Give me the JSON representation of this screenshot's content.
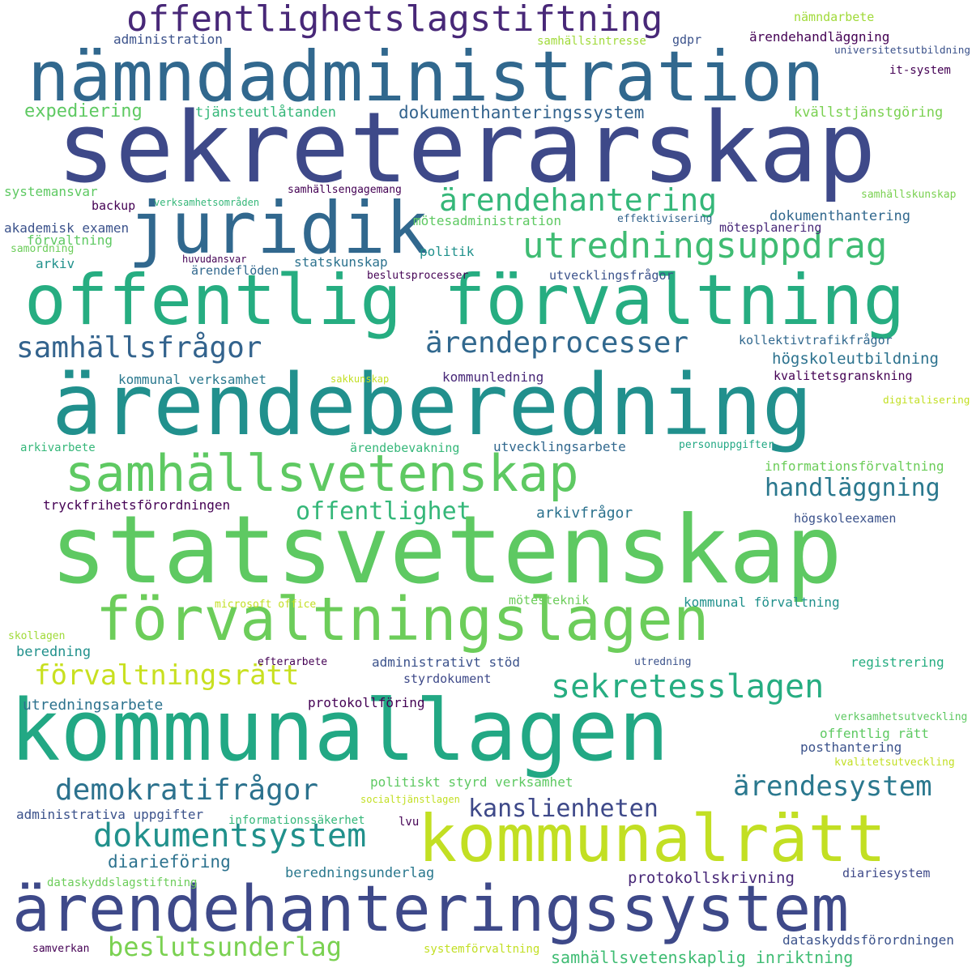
{
  "palette": {
    "background": "#ffffff",
    "dark_purple": "#440154",
    "indigo": "#3b4f8a",
    "blue": "#2f6b8e",
    "teal": "#21918c",
    "green_teal": "#28ae80",
    "green": "#5ec962",
    "light_green": "#9bd93c",
    "yellow_green": "#c2df23"
  },
  "words": [
    {
      "text": "offentlighetslagstiftning",
      "size": 44,
      "color": "#482878"
    },
    {
      "text": "nämndadministration",
      "size": 86,
      "color": "#31688e"
    },
    {
      "text": "sekreterarskap",
      "size": 120,
      "color": "#3e4989"
    },
    {
      "text": "juridik",
      "size": 88,
      "color": "#31688e"
    },
    {
      "text": "ärendehantering",
      "size": 38,
      "color": "#35b779"
    },
    {
      "text": "utredningsuppdrag",
      "size": 44,
      "color": "#3fbc73"
    },
    {
      "text": "offentlig förvaltning",
      "size": 86,
      "color": "#26ad81"
    },
    {
      "text": "samhällsfrågor",
      "size": 36,
      "color": "#33638d"
    },
    {
      "text": "ärendeprocesser",
      "size": 36,
      "color": "#31688e"
    },
    {
      "text": "ärendeberedning",
      "size": 104,
      "color": "#21908d"
    },
    {
      "text": "samhällsvetenskap",
      "size": 62,
      "color": "#5ec962"
    },
    {
      "text": "handläggning",
      "size": 30,
      "color": "#2a788e"
    },
    {
      "text": "offentlighet",
      "size": 30,
      "color": "#35b779"
    },
    {
      "text": "statsvetenskap",
      "size": 116,
      "color": "#5ec962"
    },
    {
      "text": "förvaltningslagen",
      "size": 74,
      "color": "#6ccd5a"
    },
    {
      "text": "förvaltningsrätt",
      "size": 34,
      "color": "#c8e020"
    },
    {
      "text": "sekretesslagen",
      "size": 40,
      "color": "#26ad81"
    },
    {
      "text": "kommunallagen",
      "size": 104,
      "color": "#22a884"
    },
    {
      "text": "demokratifrågor",
      "size": 36,
      "color": "#2c728e"
    },
    {
      "text": "ärendesystem",
      "size": 34,
      "color": "#2a788e"
    },
    {
      "text": "kanslienheten",
      "size": 30,
      "color": "#3e4989"
    },
    {
      "text": "dokumentsystem",
      "size": 40,
      "color": "#21918c"
    },
    {
      "text": "kommunalrätt",
      "size": 80,
      "color": "#c2df23"
    },
    {
      "text": "ärendehanteringssystem",
      "size": 78,
      "color": "#3e4989"
    },
    {
      "text": "beslutsunderlag",
      "size": 32,
      "color": "#7ad151"
    },
    {
      "text": "samhällsvetenskaplig inriktning",
      "size": 20,
      "color": "#3fbc73"
    },
    {
      "text": "administration",
      "size": 16,
      "color": "#3b528b"
    },
    {
      "text": "samhällsintresse",
      "size": 14,
      "color": "#a0da39"
    },
    {
      "text": "gdpr",
      "size": 15,
      "color": "#3b528b"
    },
    {
      "text": "nämndarbete",
      "size": 15,
      "color": "#a0da39"
    },
    {
      "text": "ärendehandläggning",
      "size": 16,
      "color": "#440154"
    },
    {
      "text": "universitetsutbildning",
      "size": 13,
      "color": "#3b528b"
    },
    {
      "text": "it-system",
      "size": 14,
      "color": "#440154"
    },
    {
      "text": "expediering",
      "size": 22,
      "color": "#5ec962"
    },
    {
      "text": "tjänsteutlåtanden",
      "size": 17,
      "color": "#35b779"
    },
    {
      "text": "dokumenthanteringssystem",
      "size": 21,
      "color": "#33638d"
    },
    {
      "text": "kvällstjänstgöring",
      "size": 17,
      "color": "#7ad151"
    },
    {
      "text": "systemansvar",
      "size": 16,
      "color": "#5ec962"
    },
    {
      "text": "samhällsengagemang",
      "size": 13,
      "color": "#440154"
    },
    {
      "text": "samhällskunskap",
      "size": 13,
      "color": "#7ad151"
    },
    {
      "text": "backup",
      "size": 15,
      "color": "#440154"
    },
    {
      "text": "verksamhetsområden",
      "size": 12,
      "color": "#35b779"
    },
    {
      "text": "mötesadministration",
      "size": 16,
      "color": "#5ec962"
    },
    {
      "text": "effektivisering",
      "size": 13,
      "color": "#33638d"
    },
    {
      "text": "dokumenthantering",
      "size": 17,
      "color": "#31688e"
    },
    {
      "text": "mötesplanering",
      "size": 15,
      "color": "#482878"
    },
    {
      "text": "akademisk examen",
      "size": 16,
      "color": "#3b528b"
    },
    {
      "text": "förvaltning",
      "size": 16,
      "color": "#5ec962"
    },
    {
      "text": "samordning",
      "size": 13,
      "color": "#6ccd5a"
    },
    {
      "text": "politik",
      "size": 16,
      "color": "#21918c"
    },
    {
      "text": "arkiv",
      "size": 16,
      "color": "#21918c"
    },
    {
      "text": "huvudansvar",
      "size": 12,
      "color": "#440154"
    },
    {
      "text": "statskunskap",
      "size": 16,
      "color": "#2c728e"
    },
    {
      "text": "ärendeflöden",
      "size": 15,
      "color": "#31688e"
    },
    {
      "text": "beslutsprocesser",
      "size": 13,
      "color": "#440154"
    },
    {
      "text": "utvecklingsfrågor",
      "size": 15,
      "color": "#3b528b"
    },
    {
      "text": "kollektivtrafikfrågor",
      "size": 15,
      "color": "#31688e"
    },
    {
      "text": "högskoleutbildning",
      "size": 19,
      "color": "#2c728e"
    },
    {
      "text": "kommunal verksamhet",
      "size": 16,
      "color": "#2a788e"
    },
    {
      "text": "sakkunskap",
      "size": 12,
      "color": "#c2df23"
    },
    {
      "text": "kommunledning",
      "size": 16,
      "color": "#482878"
    },
    {
      "text": "kvalitetsgranskning",
      "size": 15,
      "color": "#440154"
    },
    {
      "text": "digitalisering",
      "size": 13,
      "color": "#c2df23"
    },
    {
      "text": "arkivarbete",
      "size": 14,
      "color": "#35b779"
    },
    {
      "text": "ärendebevakning",
      "size": 15,
      "color": "#35b779"
    },
    {
      "text": "utvecklingsarbete",
      "size": 16,
      "color": "#31688e"
    },
    {
      "text": "personuppgifter",
      "size": 13,
      "color": "#22a884"
    },
    {
      "text": "informationsförvaltning",
      "size": 16,
      "color": "#6ccd5a"
    },
    {
      "text": "tryckfrihetsförordningen",
      "size": 16,
      "color": "#440154"
    },
    {
      "text": "arkivfrågor",
      "size": 18,
      "color": "#2c728e"
    },
    {
      "text": "högskoleexamen",
      "size": 15,
      "color": "#3b528b"
    },
    {
      "text": "microsoft office",
      "size": 13,
      "color": "#c2df23"
    },
    {
      "text": "mötesteknik",
      "size": 15,
      "color": "#6ccd5a"
    },
    {
      "text": "kommunal förvaltning",
      "size": 16,
      "color": "#21918c"
    },
    {
      "text": "skollagen",
      "size": 13,
      "color": "#a0da39"
    },
    {
      "text": "beredning",
      "size": 17,
      "color": "#21918c"
    },
    {
      "text": "efterarbete",
      "size": 13,
      "color": "#440154"
    },
    {
      "text": "administrativt stöd",
      "size": 16,
      "color": "#3b528b"
    },
    {
      "text": "utredning",
      "size": 13,
      "color": "#3b528b"
    },
    {
      "text": "registrering",
      "size": 16,
      "color": "#26ad81"
    },
    {
      "text": "styrdokument",
      "size": 15,
      "color": "#3e4989"
    },
    {
      "text": "utredningsarbete",
      "size": 18,
      "color": "#2c728e"
    },
    {
      "text": "protokollföring",
      "size": 16,
      "color": "#440154"
    },
    {
      "text": "verksamhetsutveckling",
      "size": 13,
      "color": "#5ec962"
    },
    {
      "text": "offentlig rätt",
      "size": 16,
      "color": "#5ec962"
    },
    {
      "text": "posthantering",
      "size": 16,
      "color": "#3b528b"
    },
    {
      "text": "kvalitetsutveckling",
      "size": 13,
      "color": "#c2df23"
    },
    {
      "text": "politiskt styrd verksamhet",
      "size": 16,
      "color": "#5ec962"
    },
    {
      "text": "socialtjänstlagen",
      "size": 12,
      "color": "#c2df23"
    },
    {
      "text": "administrativa uppgifter",
      "size": 16,
      "color": "#3b528b"
    },
    {
      "text": "informationssäkerhet",
      "size": 14,
      "color": "#35b779"
    },
    {
      "text": "lvu",
      "size": 14,
      "color": "#440154"
    },
    {
      "text": "diarieföring",
      "size": 21,
      "color": "#2c728e"
    },
    {
      "text": "beredningsunderlag",
      "size": 17,
      "color": "#2a788e"
    },
    {
      "text": "protokollskrivning",
      "size": 19,
      "color": "#482878"
    },
    {
      "text": "diariesystem",
      "size": 15,
      "color": "#3e4989"
    },
    {
      "text": "dataskyddslagstiftning",
      "size": 14,
      "color": "#6ccd5a"
    },
    {
      "text": "samverkan",
      "size": 13,
      "color": "#440154"
    },
    {
      "text": "systemförvaltning",
      "size": 14,
      "color": "#c2df23"
    },
    {
      "text": "dataskyddsförordningen",
      "size": 16,
      "color": "#3b528b"
    }
  ]
}
